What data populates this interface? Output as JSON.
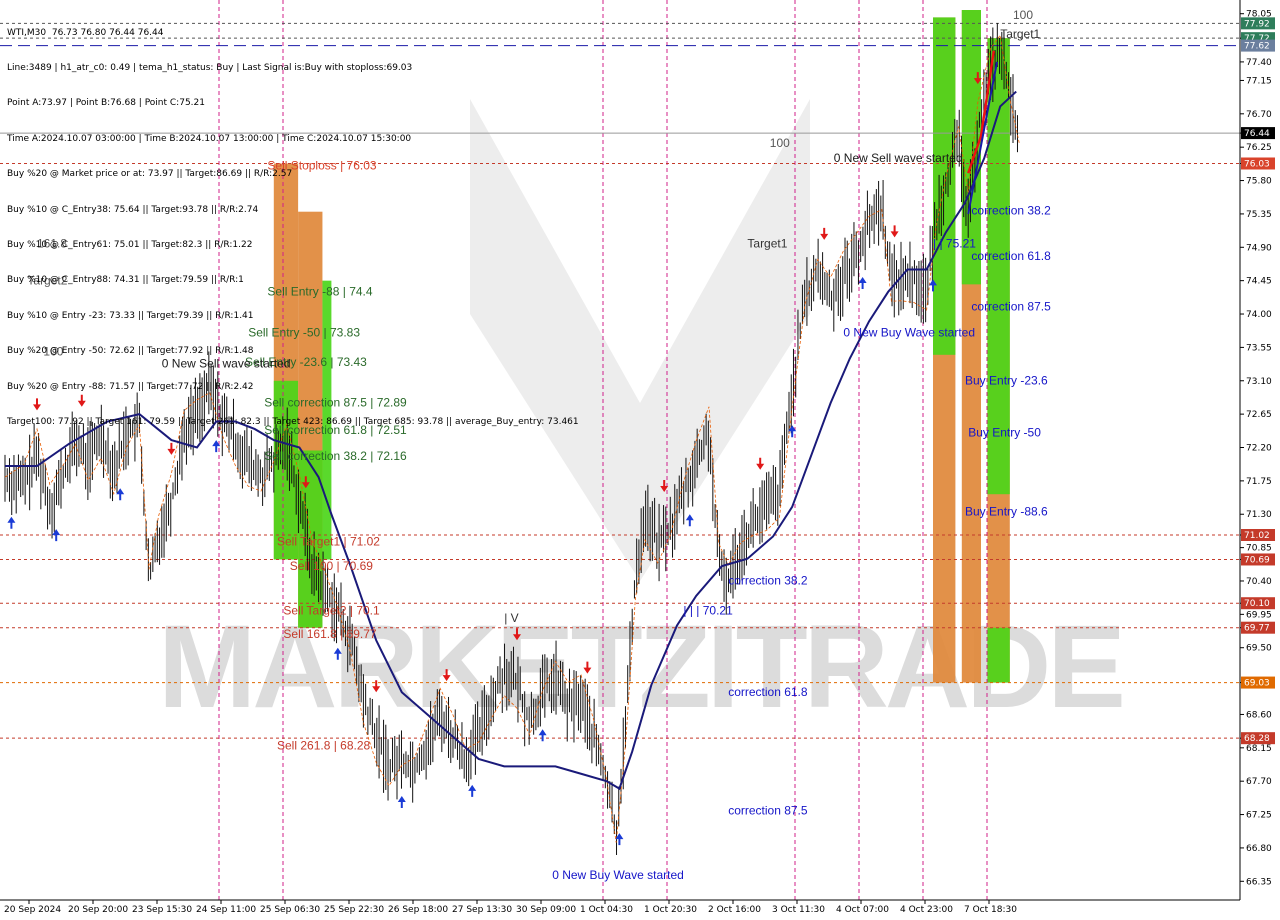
{
  "chart_data": {
    "type": "line",
    "instrument": "WTI,M30",
    "ohlc_header": "WTI,M30  76.73 76.80 76.44 76.44",
    "info_lines": [
      "Line:3489 | h1_atr_c0: 0.49 | tema_h1_status: Buy | Last Signal is:Buy with stoploss:69.03",
      "Point A:73.97 | Point B:76.68 | Point C:75.21",
      "Time A:2024.10.07 03:00:00 | Time B:2024.10.07 13:00:00 | Time C:2024.10.07 15:30:00",
      "Buy %20 @ Market price or at: 73.97 || Target:86.69 || R/R:2.57",
      "Buy %10 @ C_Entry38: 75.64 || Target:93.78 || R/R:2.74",
      "Buy %10 @ C_Entry61: 75.01 || Target:82.3 || R/R:1.22",
      "Buy %10 @ C_Entry88: 74.31 || Target:79.59 || R/R:1",
      "Buy %10 @ Entry -23: 73.33 || Target:79.39 || R/R:1.41",
      "Buy %20 @ Entry -50: 72.62 || Target:77.92 || R/R:1.48",
      "Buy %20 @ Entry -88: 71.57 || Target:77.72 || R/R:2.42",
      "Target100: 77.92 || Target 161: 79.59 || Target 261: 82.3 || Target 423: 86.69 || Target 685: 93.78 || average_Buy_entry: 73.461"
    ],
    "y_range": [
      66.3,
      78.1
    ],
    "y_ticks": [
      "78.05",
      "77.72",
      "77.40",
      "77.15",
      "76.70",
      "76.44",
      "76.25",
      "76.03",
      "75.80",
      "75.35",
      "74.90",
      "74.45",
      "74.00",
      "73.55",
      "73.10",
      "72.65",
      "72.20",
      "71.75",
      "71.30",
      "71.02",
      "70.85",
      "70.69",
      "70.40",
      "70.10",
      "69.95",
      "69.77",
      "69.50",
      "69.03",
      "68.60",
      "68.28",
      "68.15",
      "67.70",
      "67.25",
      "66.80",
      "66.35"
    ],
    "x_ticks": [
      "20 Sep 2024",
      "20 Sep 20:00",
      "23 Sep 15:30",
      "24 Sep 11:00",
      "25 Sep 06:30",
      "25 Sep 22:30",
      "26 Sep 18:00",
      "27 Sep 13:30",
      "30 Sep 09:00",
      "1 Oct 04:30",
      "1 Oct 20:30",
      "2 Oct 16:00",
      "3 Oct 11:30",
      "4 Oct 07:00",
      "4 Oct 23:00",
      "7 Oct 18:30"
    ],
    "price_close": 76.44,
    "current_price_label": "76.44",
    "price_badges": [
      {
        "value": 77.92,
        "label": "77.92",
        "color": "#2e7d5b"
      },
      {
        "value": 77.72,
        "label": "77.72",
        "color": "#2e7d5b"
      },
      {
        "value": 77.62,
        "label": "77.62",
        "color": "#6b7f9e"
      },
      {
        "value": 76.03,
        "label": "76.03",
        "color": "#d9432b"
      },
      {
        "value": 71.02,
        "label": "71.02",
        "color": "#c43a2a"
      },
      {
        "value": 70.69,
        "label": "70.69",
        "color": "#c43a2a"
      },
      {
        "value": 70.1,
        "label": "70.10",
        "color": "#c43a2a"
      },
      {
        "value": 69.77,
        "label": "69.77",
        "color": "#c43a2a"
      },
      {
        "value": 69.03,
        "label": "69.03",
        "color": "#e06a00"
      },
      {
        "value": 68.28,
        "label": "68.28",
        "color": "#c43a2a"
      }
    ],
    "levels": [
      {
        "value": 77.92,
        "color": "#555555",
        "style": "dashed"
      },
      {
        "value": 77.72,
        "color": "#555555",
        "style": "dashed"
      },
      {
        "value": 77.62,
        "color": "#1a1aa8",
        "style": "longdash"
      },
      {
        "value": 76.44,
        "color": "#999999",
        "style": "solid"
      },
      {
        "value": 76.03,
        "color": "#c43a2a",
        "style": "dashed"
      },
      {
        "value": 71.02,
        "color": "#c43a2a",
        "style": "dashed"
      },
      {
        "value": 70.69,
        "color": "#c43a2a",
        "style": "dashed"
      },
      {
        "value": 70.1,
        "color": "#c43a2a",
        "style": "dashed"
      },
      {
        "value": 69.77,
        "color": "#c43a2a",
        "style": "dashed"
      },
      {
        "value": 69.03,
        "color": "#e06a00",
        "style": "dashed"
      },
      {
        "value": 68.28,
        "color": "#c43a2a",
        "style": "dashed"
      }
    ],
    "vlines_magenta": [
      "24 Sep 11:00",
      "25 Sep 06:30",
      "1 Oct 04:30",
      "1 Oct 20:30",
      "3 Oct 11:30",
      "4 Oct 07:00",
      "4 Oct 23:00",
      "7 Oct 18:30"
    ],
    "zones_sell": [
      {
        "t0": 4.2,
        "t1": 4.58,
        "lo": 70.69,
        "hi": 76.03,
        "color": "#e0883a"
      },
      {
        "t0": 4.2,
        "t1": 4.58,
        "lo": 70.69,
        "hi": 73.1,
        "color": "#4cd61a"
      },
      {
        "t0": 4.58,
        "t1": 4.96,
        "lo": 69.77,
        "hi": 75.38,
        "color": "#e0883a"
      },
      {
        "t0": 4.58,
        "t1": 4.96,
        "lo": 69.77,
        "hi": 72.16,
        "color": "#4cd61a"
      },
      {
        "t0": 4.96,
        "t1": 5.1,
        "lo": 70.69,
        "hi": 74.45,
        "color": "#4cd61a"
      }
    ],
    "zones_buy": [
      {
        "t0": 14.5,
        "t1": 14.85,
        "lo": 69.03,
        "hi": 78.0,
        "color": "#e0883a"
      },
      {
        "t0": 14.5,
        "t1": 14.85,
        "lo": 73.45,
        "hi": 78.0,
        "color": "#4cd61a"
      },
      {
        "t0": 14.95,
        "t1": 15.25,
        "lo": 69.03,
        "hi": 78.1,
        "color": "#e0883a"
      },
      {
        "t0": 14.95,
        "t1": 15.25,
        "lo": 74.4,
        "hi": 78.1,
        "color": "#4cd61a"
      },
      {
        "t0": 15.35,
        "t1": 15.7,
        "lo": 69.03,
        "hi": 77.72,
        "color": "#e0883a"
      },
      {
        "t0": 15.35,
        "t1": 15.7,
        "lo": 71.57,
        "hi": 77.72,
        "color": "#4cd61a"
      },
      {
        "t0": 15.35,
        "t1": 15.7,
        "lo": 69.03,
        "hi": 69.77,
        "color": "#4cd61a"
      }
    ],
    "close_path": [
      [
        0.0,
        71.8
      ],
      [
        0.3,
        71.7
      ],
      [
        0.5,
        72.1
      ],
      [
        0.7,
        71.4
      ],
      [
        0.9,
        71.8
      ],
      [
        1.1,
        72.3
      ],
      [
        1.3,
        72.0
      ],
      [
        1.5,
        72.4
      ],
      [
        1.7,
        71.9
      ],
      [
        1.9,
        72.4
      ],
      [
        2.1,
        72.5
      ],
      [
        2.25,
        70.4
      ],
      [
        2.4,
        71.0
      ],
      [
        2.6,
        71.5
      ],
      [
        2.8,
        72.4
      ],
      [
        3.0,
        72.7
      ],
      [
        3.2,
        73.0
      ],
      [
        3.4,
        72.6
      ],
      [
        3.6,
        72.3
      ],
      [
        3.8,
        72.0
      ],
      [
        4.0,
        71.8
      ],
      [
        4.2,
        72.0
      ],
      [
        4.4,
        72.3
      ],
      [
        4.6,
        71.5
      ],
      [
        4.8,
        70.6
      ],
      [
        5.0,
        70.3
      ],
      [
        5.2,
        70.0
      ],
      [
        5.4,
        69.6
      ],
      [
        5.6,
        68.8
      ],
      [
        5.8,
        68.3
      ],
      [
        6.0,
        67.9
      ],
      [
        6.2,
        68.0
      ],
      [
        6.4,
        67.9
      ],
      [
        6.6,
        68.2
      ],
      [
        6.8,
        68.6
      ],
      [
        7.0,
        68.3
      ],
      [
        7.2,
        68.0
      ],
      [
        7.4,
        68.3
      ],
      [
        7.6,
        68.8
      ],
      [
        7.8,
        69.2
      ],
      [
        8.0,
        69.0
      ],
      [
        8.2,
        68.5
      ],
      [
        8.4,
        68.9
      ],
      [
        8.6,
        69.1
      ],
      [
        8.8,
        68.7
      ],
      [
        9.0,
        68.8
      ],
      [
        9.2,
        68.3
      ],
      [
        9.4,
        67.7
      ],
      [
        9.55,
        67.0
      ],
      [
        9.7,
        68.5
      ],
      [
        9.85,
        70.5
      ],
      [
        10.0,
        71.3
      ],
      [
        10.2,
        70.9
      ],
      [
        10.4,
        71.1
      ],
      [
        10.6,
        71.6
      ],
      [
        10.8,
        72.0
      ],
      [
        11.0,
        72.4
      ],
      [
        11.15,
        70.6
      ],
      [
        11.3,
        70.4
      ],
      [
        11.5,
        70.9
      ],
      [
        11.7,
        71.2
      ],
      [
        11.9,
        71.4
      ],
      [
        12.1,
        71.6
      ],
      [
        12.3,
        73.0
      ],
      [
        12.5,
        74.2
      ],
      [
        12.7,
        74.6
      ],
      [
        12.9,
        74.2
      ],
      [
        13.1,
        74.5
      ],
      [
        13.3,
        74.8
      ],
      [
        13.5,
        75.2
      ],
      [
        13.7,
        75.5
      ],
      [
        13.85,
        74.4
      ],
      [
        14.0,
        74.5
      ],
      [
        14.2,
        74.5
      ],
      [
        14.4,
        74.3
      ],
      [
        14.55,
        75.3
      ],
      [
        14.7,
        75.8
      ],
      [
        14.9,
        76.3
      ],
      [
        15.05,
        75.3
      ],
      [
        15.2,
        76.5
      ],
      [
        15.4,
        77.3
      ],
      [
        15.55,
        77.6
      ],
      [
        15.7,
        76.9
      ],
      [
        15.85,
        76.44
      ]
    ],
    "ma_path": [
      [
        0.0,
        71.95
      ],
      [
        0.5,
        71.95
      ],
      [
        1.0,
        72.25
      ],
      [
        1.6,
        72.55
      ],
      [
        2.1,
        72.65
      ],
      [
        2.6,
        72.3
      ],
      [
        3.0,
        72.2
      ],
      [
        3.3,
        72.55
      ],
      [
        3.6,
        72.55
      ],
      [
        3.9,
        72.45
      ],
      [
        4.2,
        72.3
      ],
      [
        4.6,
        72.2
      ],
      [
        4.9,
        71.8
      ],
      [
        5.1,
        71.3
      ],
      [
        5.4,
        70.6
      ],
      [
        5.8,
        69.6
      ],
      [
        6.2,
        68.9
      ],
      [
        6.6,
        68.6
      ],
      [
        7.0,
        68.3
      ],
      [
        7.4,
        68.0
      ],
      [
        7.8,
        67.9
      ],
      [
        8.2,
        67.9
      ],
      [
        8.6,
        67.9
      ],
      [
        9.0,
        67.8
      ],
      [
        9.4,
        67.7
      ],
      [
        9.6,
        67.6
      ],
      [
        9.8,
        68.1
      ],
      [
        10.1,
        69.0
      ],
      [
        10.5,
        69.8
      ],
      [
        10.8,
        70.2
      ],
      [
        11.2,
        70.6
      ],
      [
        11.6,
        70.7
      ],
      [
        12.0,
        71.0
      ],
      [
        12.3,
        71.4
      ],
      [
        12.6,
        72.1
      ],
      [
        12.9,
        72.8
      ],
      [
        13.2,
        73.4
      ],
      [
        13.5,
        73.9
      ],
      [
        13.8,
        74.3
      ],
      [
        14.1,
        74.6
      ],
      [
        14.4,
        74.6
      ],
      [
        14.7,
        75.1
      ],
      [
        15.0,
        75.5
      ],
      [
        15.3,
        76.1
      ],
      [
        15.55,
        76.8
      ],
      [
        15.8,
        77.0
      ]
    ],
    "buy_triangle_line": [
      [
        15.05,
        75.35
      ],
      [
        15.3,
        76.5
      ],
      [
        15.5,
        77.4
      ]
    ],
    "sell_triangle_line": [
      [
        15.05,
        75.9
      ],
      [
        15.25,
        76.4
      ],
      [
        15.45,
        77.55
      ]
    ],
    "labels": [
      {
        "text": "Target1",
        "t": 15.55,
        "v": 77.72,
        "color": "#333333"
      },
      {
        "text": "100",
        "t": 15.75,
        "v": 77.98,
        "color": "#555555"
      },
      {
        "text": "100",
        "t": 11.95,
        "v": 76.25,
        "color": "#555555"
      },
      {
        "text": "0 New Sell wave started",
        "t": 12.95,
        "v": 76.05,
        "color": "#1a1a1a"
      },
      {
        "text": "Sell Stoploss | 76.03",
        "t": 4.1,
        "v": 75.95,
        "color": "#d9432b"
      },
      {
        "text": "161.8",
        "t": 0.5,
        "v": 74.9,
        "color": "#555555"
      },
      {
        "text": "Target2",
        "t": 0.35,
        "v": 74.4,
        "color": "#555555"
      },
      {
        "text": "Target1",
        "t": 11.6,
        "v": 74.9,
        "color": "#333333"
      },
      {
        "text": "correction 38.2",
        "t": 15.1,
        "v": 75.34,
        "color": "#1515c8"
      },
      {
        "text": "| | 75.21",
        "t": 14.5,
        "v": 74.9,
        "color": "#1515c8"
      },
      {
        "text": "correction 61.8",
        "t": 15.1,
        "v": 74.73,
        "color": "#1515c8"
      },
      {
        "text": "correction 87.5",
        "t": 15.1,
        "v": 74.05,
        "color": "#1515c8"
      },
      {
        "text": "Sell Entry -88 | 74.4",
        "t": 4.1,
        "v": 74.25,
        "color": "#2a6a2a"
      },
      {
        "text": "0 New Buy Wave started",
        "t": 13.1,
        "v": 73.7,
        "color": "#1515c8"
      },
      {
        "text": "Sell Entry -50 | 73.83",
        "t": 3.8,
        "v": 73.7,
        "color": "#2a6a2a"
      },
      {
        "text": "Sell Entry -23.6 | 73.43",
        "t": 3.75,
        "v": 73.3,
        "color": "#2a6a2a"
      },
      {
        "text": "0 New Sell wave started",
        "t": 2.45,
        "v": 73.28,
        "color": "#1a1a1a"
      },
      {
        "text": "100",
        "t": 0.6,
        "v": 73.44,
        "color": "#555555"
      },
      {
        "text": "Buy Entry -23.6",
        "t": 15.0,
        "v": 73.05,
        "color": "#1515c8"
      },
      {
        "text": "Sell correction 87.5 | 72.89",
        "t": 4.05,
        "v": 72.75,
        "color": "#2a6a2a"
      },
      {
        "text": "Buy Entry -50",
        "t": 15.05,
        "v": 72.35,
        "color": "#1515c8"
      },
      {
        "text": "Sell correction 61.8 | 72.51",
        "t": 4.05,
        "v": 72.38,
        "color": "#2a6a2a"
      },
      {
        "text": "Sell correction 38.2 | 72.16",
        "t": 4.05,
        "v": 72.03,
        "color": "#2a6a2a"
      },
      {
        "text": "Buy Entry -88.6",
        "t": 15.0,
        "v": 71.28,
        "color": "#1515c8"
      },
      {
        "text": "Sell Target1 | 71.02",
        "t": 4.25,
        "v": 70.88,
        "color": "#c43a2a"
      },
      {
        "text": "Sell 100 | 70.69",
        "t": 4.45,
        "v": 70.55,
        "color": "#c43a2a"
      },
      {
        "text": "correction 38.2",
        "t": 11.3,
        "v": 70.35,
        "color": "#1515c8"
      },
      {
        "text": "| | | 70.21",
        "t": 10.6,
        "v": 69.95,
        "color": "#1515c8"
      },
      {
        "text": "Sell Target2 | 70.1",
        "t": 4.35,
        "v": 69.95,
        "color": "#c43a2a"
      },
      {
        "text": "Sell 161.8 | 69.77",
        "t": 4.35,
        "v": 69.63,
        "color": "#c43a2a"
      },
      {
        "text": "| V",
        "t": 7.8,
        "v": 69.85,
        "color": "#333333"
      },
      {
        "text": "correction 61.8",
        "t": 11.3,
        "v": 68.85,
        "color": "#1515c8"
      },
      {
        "text": "Sell 261.8 | 68.28",
        "t": 4.25,
        "v": 68.13,
        "color": "#c43a2a"
      },
      {
        "text": "correction 87.5",
        "t": 11.3,
        "v": 67.25,
        "color": "#1515c8"
      },
      {
        "text": "0 New Buy Wave started",
        "t": 8.55,
        "v": 66.38,
        "color": "#1515c8"
      }
    ],
    "watermark": "MARKETZITRADE",
    "grid": false
  }
}
